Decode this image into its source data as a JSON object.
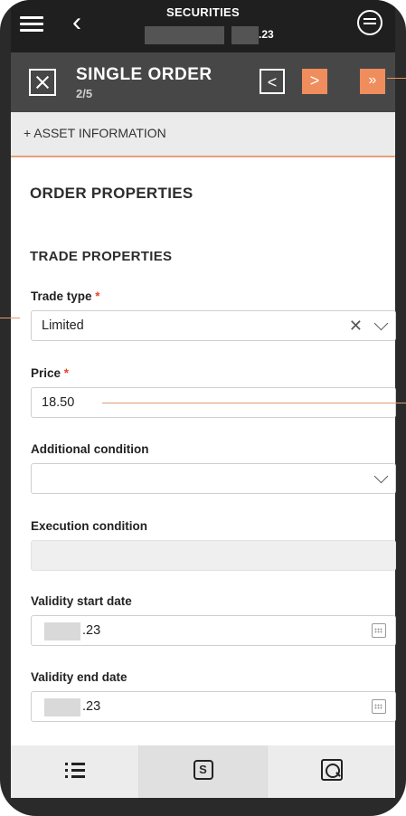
{
  "topbar": {
    "title": "SECURITIES",
    "value": ".23"
  },
  "order_header": {
    "title": "SINGLE ORDER",
    "step": "2/5",
    "prev_glyph": "<",
    "next_glyph": ">",
    "last_glyph": "»"
  },
  "asset_info": {
    "label": "+ ASSET INFORMATION"
  },
  "sections": {
    "order_properties": "ORDER PROPERTIES",
    "trade_properties": "TRADE PROPERTIES"
  },
  "fields": {
    "trade_type": {
      "label": "Trade type",
      "required_mark": "*",
      "value": "Limited"
    },
    "price": {
      "label": "Price",
      "required_mark": "*",
      "value": "18.50"
    },
    "additional_condition": {
      "label": "Additional condition",
      "value": ""
    },
    "execution_condition": {
      "label": "Execution condition",
      "value": ""
    },
    "validity_start": {
      "label": "Validity start date",
      "value": ".23"
    },
    "validity_end": {
      "label": "Validity end date",
      "value": ".23"
    }
  },
  "colors": {
    "accent": "#f08d5c",
    "header": "#474747",
    "topbar": "#1f1f1f",
    "required": "#e8442f"
  },
  "icons": [
    "menu-icon",
    "back-icon",
    "coin-icon",
    "close-icon",
    "list-icon",
    "s-icon",
    "search-icon",
    "calendar-icon"
  ]
}
